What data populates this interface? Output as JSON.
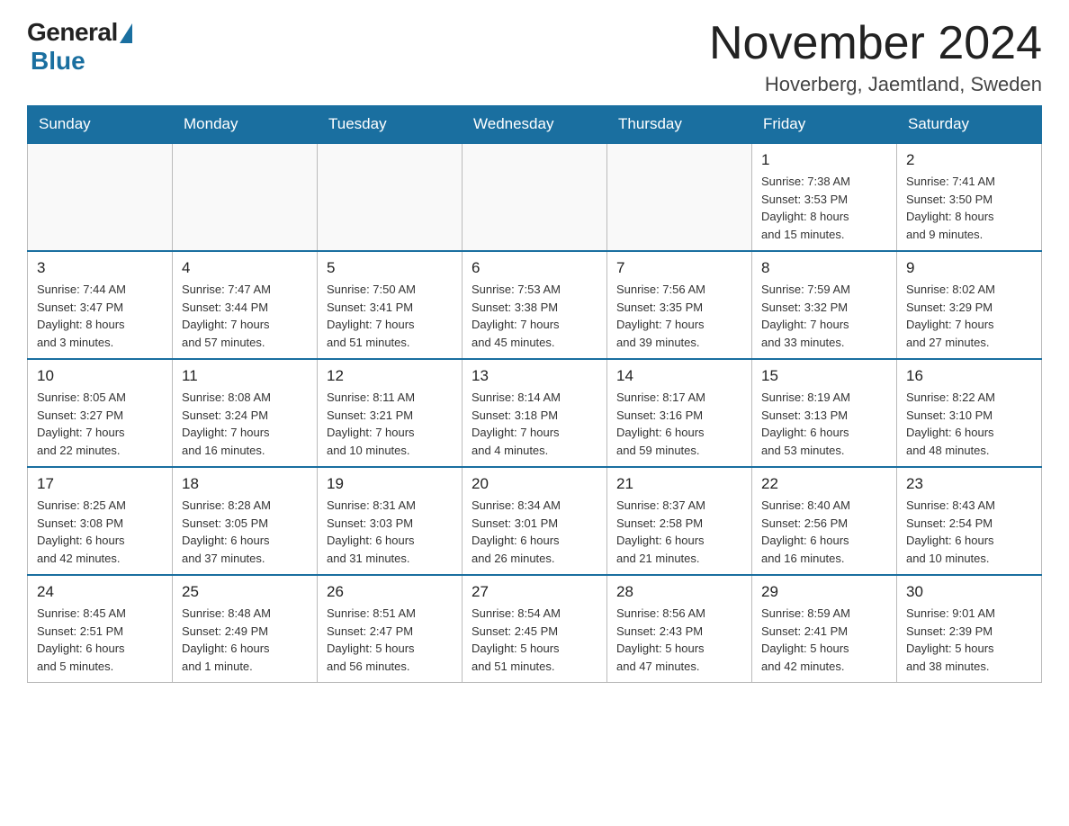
{
  "header": {
    "logo_general": "General",
    "logo_blue": "Blue",
    "month_title": "November 2024",
    "location": "Hoverberg, Jaemtland, Sweden"
  },
  "weekdays": [
    "Sunday",
    "Monday",
    "Tuesday",
    "Wednesday",
    "Thursday",
    "Friday",
    "Saturday"
  ],
  "rows": [
    [
      {
        "day": "",
        "info": ""
      },
      {
        "day": "",
        "info": ""
      },
      {
        "day": "",
        "info": ""
      },
      {
        "day": "",
        "info": ""
      },
      {
        "day": "",
        "info": ""
      },
      {
        "day": "1",
        "info": "Sunrise: 7:38 AM\nSunset: 3:53 PM\nDaylight: 8 hours\nand 15 minutes."
      },
      {
        "day": "2",
        "info": "Sunrise: 7:41 AM\nSunset: 3:50 PM\nDaylight: 8 hours\nand 9 minutes."
      }
    ],
    [
      {
        "day": "3",
        "info": "Sunrise: 7:44 AM\nSunset: 3:47 PM\nDaylight: 8 hours\nand 3 minutes."
      },
      {
        "day": "4",
        "info": "Sunrise: 7:47 AM\nSunset: 3:44 PM\nDaylight: 7 hours\nand 57 minutes."
      },
      {
        "day": "5",
        "info": "Sunrise: 7:50 AM\nSunset: 3:41 PM\nDaylight: 7 hours\nand 51 minutes."
      },
      {
        "day": "6",
        "info": "Sunrise: 7:53 AM\nSunset: 3:38 PM\nDaylight: 7 hours\nand 45 minutes."
      },
      {
        "day": "7",
        "info": "Sunrise: 7:56 AM\nSunset: 3:35 PM\nDaylight: 7 hours\nand 39 minutes."
      },
      {
        "day": "8",
        "info": "Sunrise: 7:59 AM\nSunset: 3:32 PM\nDaylight: 7 hours\nand 33 minutes."
      },
      {
        "day": "9",
        "info": "Sunrise: 8:02 AM\nSunset: 3:29 PM\nDaylight: 7 hours\nand 27 minutes."
      }
    ],
    [
      {
        "day": "10",
        "info": "Sunrise: 8:05 AM\nSunset: 3:27 PM\nDaylight: 7 hours\nand 22 minutes."
      },
      {
        "day": "11",
        "info": "Sunrise: 8:08 AM\nSunset: 3:24 PM\nDaylight: 7 hours\nand 16 minutes."
      },
      {
        "day": "12",
        "info": "Sunrise: 8:11 AM\nSunset: 3:21 PM\nDaylight: 7 hours\nand 10 minutes."
      },
      {
        "day": "13",
        "info": "Sunrise: 8:14 AM\nSunset: 3:18 PM\nDaylight: 7 hours\nand 4 minutes."
      },
      {
        "day": "14",
        "info": "Sunrise: 8:17 AM\nSunset: 3:16 PM\nDaylight: 6 hours\nand 59 minutes."
      },
      {
        "day": "15",
        "info": "Sunrise: 8:19 AM\nSunset: 3:13 PM\nDaylight: 6 hours\nand 53 minutes."
      },
      {
        "day": "16",
        "info": "Sunrise: 8:22 AM\nSunset: 3:10 PM\nDaylight: 6 hours\nand 48 minutes."
      }
    ],
    [
      {
        "day": "17",
        "info": "Sunrise: 8:25 AM\nSunset: 3:08 PM\nDaylight: 6 hours\nand 42 minutes."
      },
      {
        "day": "18",
        "info": "Sunrise: 8:28 AM\nSunset: 3:05 PM\nDaylight: 6 hours\nand 37 minutes."
      },
      {
        "day": "19",
        "info": "Sunrise: 8:31 AM\nSunset: 3:03 PM\nDaylight: 6 hours\nand 31 minutes."
      },
      {
        "day": "20",
        "info": "Sunrise: 8:34 AM\nSunset: 3:01 PM\nDaylight: 6 hours\nand 26 minutes."
      },
      {
        "day": "21",
        "info": "Sunrise: 8:37 AM\nSunset: 2:58 PM\nDaylight: 6 hours\nand 21 minutes."
      },
      {
        "day": "22",
        "info": "Sunrise: 8:40 AM\nSunset: 2:56 PM\nDaylight: 6 hours\nand 16 minutes."
      },
      {
        "day": "23",
        "info": "Sunrise: 8:43 AM\nSunset: 2:54 PM\nDaylight: 6 hours\nand 10 minutes."
      }
    ],
    [
      {
        "day": "24",
        "info": "Sunrise: 8:45 AM\nSunset: 2:51 PM\nDaylight: 6 hours\nand 5 minutes."
      },
      {
        "day": "25",
        "info": "Sunrise: 8:48 AM\nSunset: 2:49 PM\nDaylight: 6 hours\nand 1 minute."
      },
      {
        "day": "26",
        "info": "Sunrise: 8:51 AM\nSunset: 2:47 PM\nDaylight: 5 hours\nand 56 minutes."
      },
      {
        "day": "27",
        "info": "Sunrise: 8:54 AM\nSunset: 2:45 PM\nDaylight: 5 hours\nand 51 minutes."
      },
      {
        "day": "28",
        "info": "Sunrise: 8:56 AM\nSunset: 2:43 PM\nDaylight: 5 hours\nand 47 minutes."
      },
      {
        "day": "29",
        "info": "Sunrise: 8:59 AM\nSunset: 2:41 PM\nDaylight: 5 hours\nand 42 minutes."
      },
      {
        "day": "30",
        "info": "Sunrise: 9:01 AM\nSunset: 2:39 PM\nDaylight: 5 hours\nand 38 minutes."
      }
    ]
  ]
}
